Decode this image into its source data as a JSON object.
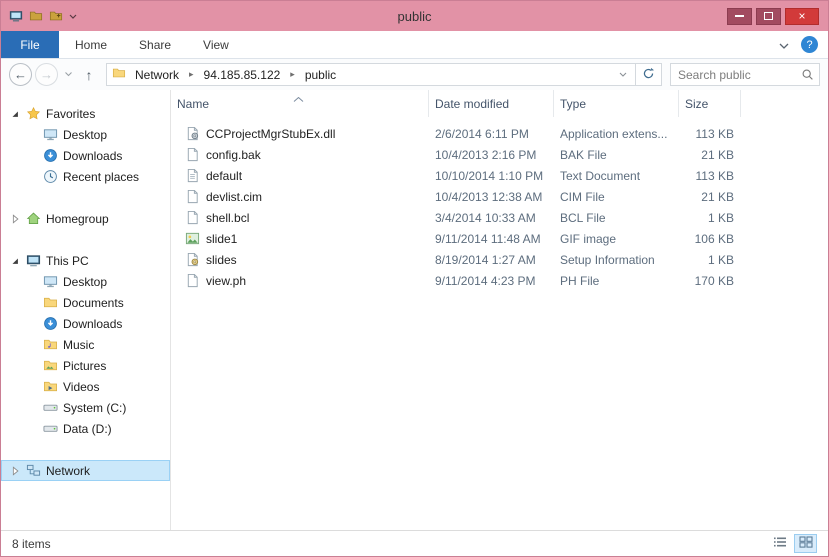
{
  "window": {
    "title": "public"
  },
  "glyphs": {
    "back": "←",
    "forward": "→",
    "up": "↑",
    "close": "×",
    "help": "?",
    "crumb_sep": "▸"
  },
  "ribbon": {
    "tabs": [
      "File",
      "Home",
      "Share",
      "View"
    ]
  },
  "address": {
    "breadcrumb": [
      "Network",
      "94.185.85.122",
      "public"
    ],
    "search_placeholder": "Search public"
  },
  "sidebar": {
    "items": [
      {
        "label": "Favorites",
        "icon": "star-icon",
        "level": 0,
        "state": "expanded"
      },
      {
        "label": "Desktop",
        "icon": "desktop-icon",
        "level": 1
      },
      {
        "label": "Downloads",
        "icon": "downloads-icon",
        "level": 1
      },
      {
        "label": "Recent places",
        "icon": "recent-places-icon",
        "level": 1
      },
      {
        "label": "Homegroup",
        "icon": "homegroup-icon",
        "level": 0,
        "state": "collapsed"
      },
      {
        "label": "This PC",
        "icon": "computer-icon",
        "level": 0,
        "state": "expanded"
      },
      {
        "label": "Desktop",
        "icon": "desktop-icon",
        "level": 1
      },
      {
        "label": "Documents",
        "icon": "folder-icon",
        "level": 1
      },
      {
        "label": "Downloads",
        "icon": "downloads-icon",
        "level": 1
      },
      {
        "label": "Music",
        "icon": "folder-icon",
        "level": 1
      },
      {
        "label": "Pictures",
        "icon": "folder-icon",
        "level": 1
      },
      {
        "label": "Videos",
        "icon": "folder-icon",
        "level": 1
      },
      {
        "label": "System (C:)",
        "icon": "drive-icon",
        "level": 1
      },
      {
        "label": "Data (D:)",
        "icon": "drive-icon",
        "level": 1
      },
      {
        "label": "Network",
        "icon": "network-icon",
        "level": 0,
        "state": "collapsed",
        "selected": true
      }
    ]
  },
  "file_list": {
    "columns": [
      "Name",
      "Date modified",
      "Type",
      "Size"
    ],
    "files": [
      {
        "name": "CCProjectMgrStubEx.dll",
        "modified": "2/6/2014 6:11 PM",
        "type": "Application extens...",
        "size": "113 KB",
        "icon": "dll-file-icon"
      },
      {
        "name": "config.bak",
        "modified": "10/4/2013 2:16 PM",
        "type": "BAK File",
        "size": "21 KB",
        "icon": "generic-file-icon"
      },
      {
        "name": "default",
        "modified": "10/10/2014 1:10 PM",
        "type": "Text Document",
        "size": "113 KB",
        "icon": "text-file-icon"
      },
      {
        "name": "devlist.cim",
        "modified": "10/4/2013 12:38 AM",
        "type": "CIM File",
        "size": "21 KB",
        "icon": "generic-file-icon"
      },
      {
        "name": "shell.bcl",
        "modified": "3/4/2014 10:33 AM",
        "type": "BCL File",
        "size": "1 KB",
        "icon": "generic-file-icon"
      },
      {
        "name": "slide1",
        "modified": "9/11/2014 11:48 AM",
        "type": "GIF image",
        "size": "106 KB",
        "icon": "image-file-icon"
      },
      {
        "name": "slides",
        "modified": "8/19/2014 1:27 AM",
        "type": "Setup Information",
        "size": "1 KB",
        "icon": "setup-file-icon"
      },
      {
        "name": "view.ph",
        "modified": "9/11/2014 4:23 PM",
        "type": "PH File",
        "size": "170 KB",
        "icon": "generic-file-icon"
      }
    ]
  },
  "status": {
    "items_text": "8 items"
  },
  "colors": {
    "titlebar": "#e292a6",
    "file_tab_blue": "#2a6db6",
    "close_red": "#d23a3a",
    "selection_bg": "#cbe8fa",
    "selection_border": "#9ad1f5"
  }
}
